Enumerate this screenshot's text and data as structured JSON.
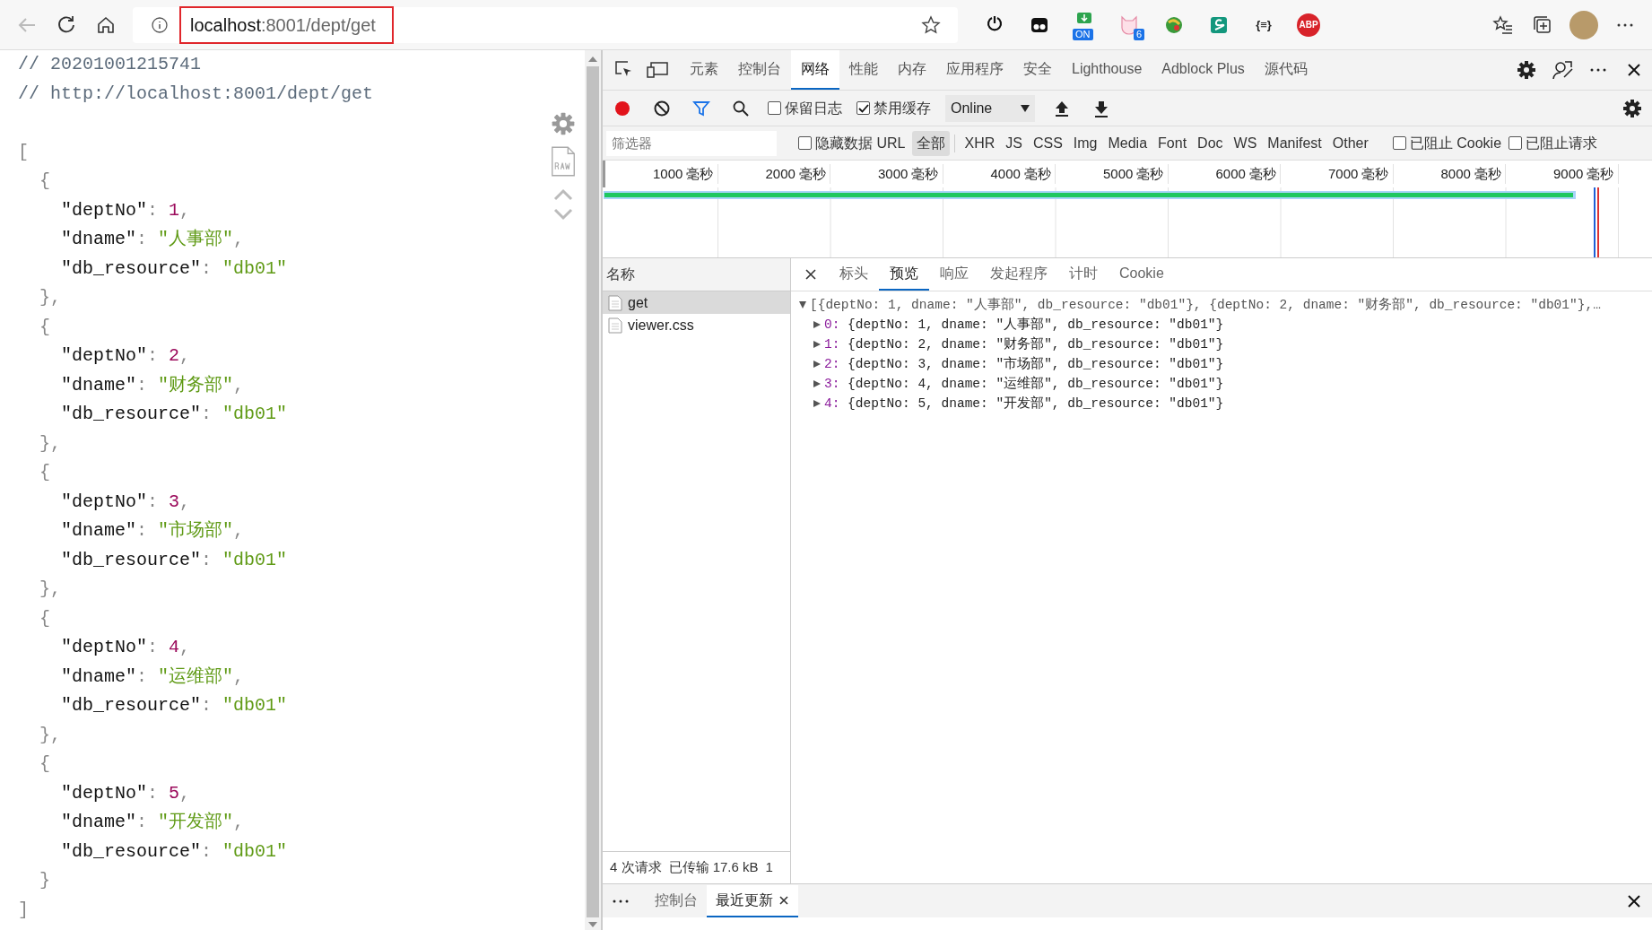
{
  "browser": {
    "url": {
      "host": "localhost",
      "path": ":8001/dept/get"
    },
    "extensions": [
      {
        "kind": "power"
      },
      {
        "kind": "eyes"
      },
      {
        "kind": "tile",
        "badge": "ON"
      },
      {
        "kind": "cat",
        "badge": "6"
      },
      {
        "kind": "globe"
      },
      {
        "kind": "wave"
      },
      {
        "kind": "text",
        "text": "{≡}"
      },
      {
        "kind": "stop",
        "text": "ABP"
      }
    ]
  },
  "viewer": {
    "comments": [
      "// 20201001215741",
      "// http://localhost:8001/dept/get"
    ],
    "open": "[",
    "close": "]",
    "records": [
      {
        "open": "{",
        "close": "},",
        "fields": [
          {
            "key": "\"deptNo\"",
            "colon": ":",
            "value": "1",
            "comma": ",",
            "kind": "number"
          },
          {
            "key": "\"dname\"",
            "colon": ":",
            "value": "\"人事部\"",
            "comma": ",",
            "kind": "string"
          },
          {
            "key": "\"db_resource\"",
            "colon": ":",
            "value": "\"db01\"",
            "kind": "string"
          }
        ]
      },
      {
        "open": "{",
        "close": "},",
        "fields": [
          {
            "key": "\"deptNo\"",
            "colon": ":",
            "value": "2",
            "comma": ",",
            "kind": "number"
          },
          {
            "key": "\"dname\"",
            "colon": ":",
            "value": "\"财务部\"",
            "comma": ",",
            "kind": "string"
          },
          {
            "key": "\"db_resource\"",
            "colon": ":",
            "value": "\"db01\"",
            "kind": "string"
          }
        ]
      },
      {
        "open": "{",
        "close": "},",
        "fields": [
          {
            "key": "\"deptNo\"",
            "colon": ":",
            "value": "3",
            "comma": ",",
            "kind": "number"
          },
          {
            "key": "\"dname\"",
            "colon": ":",
            "value": "\"市场部\"",
            "comma": ",",
            "kind": "string"
          },
          {
            "key": "\"db_resource\"",
            "colon": ":",
            "value": "\"db01\"",
            "kind": "string"
          }
        ]
      },
      {
        "open": "{",
        "close": "},",
        "fields": [
          {
            "key": "\"deptNo\"",
            "colon": ":",
            "value": "4",
            "comma": ",",
            "kind": "number"
          },
          {
            "key": "\"dname\"",
            "colon": ":",
            "value": "\"运维部\"",
            "comma": ",",
            "kind": "string"
          },
          {
            "key": "\"db_resource\"",
            "colon": ":",
            "value": "\"db01\"",
            "kind": "string"
          }
        ]
      },
      {
        "open": "{",
        "close": "}",
        "fields": [
          {
            "key": "\"deptNo\"",
            "colon": ":",
            "value": "5",
            "comma": ",",
            "kind": "number"
          },
          {
            "key": "\"dname\"",
            "colon": ":",
            "value": "\"开发部\"",
            "comma": ",",
            "kind": "string"
          },
          {
            "key": "\"db_resource\"",
            "colon": ":",
            "value": "\"db01\"",
            "kind": "string"
          }
        ]
      }
    ]
  },
  "devtools": {
    "tabs": [
      {
        "label": "元素",
        "selected": false
      },
      {
        "label": "控制台",
        "selected": false
      },
      {
        "label": "网络",
        "selected": true
      },
      {
        "label": "性能",
        "selected": false
      },
      {
        "label": "内存",
        "selected": false
      },
      {
        "label": "应用程序",
        "selected": false
      },
      {
        "label": "安全",
        "selected": false
      },
      {
        "label": "Lighthouse",
        "selected": false
      },
      {
        "label": "Adblock Plus",
        "selected": false
      },
      {
        "label": "源代码",
        "selected": false
      }
    ],
    "toolbar": {
      "recording": true,
      "filter_active": true,
      "preserve_log": {
        "label": "保留日志",
        "checked": false
      },
      "disable_cache": {
        "label": "禁用缓存",
        "checked": true
      },
      "throttling": "Online"
    },
    "filter_bar": {
      "placeholder": "筛选器",
      "hide_data_urls": {
        "label": "隐藏数据 URL",
        "checked": false
      },
      "types": [
        {
          "label": "全部",
          "selected": true
        },
        {
          "label": "XHR",
          "selected": false
        },
        {
          "label": "JS",
          "selected": false
        },
        {
          "label": "CSS",
          "selected": false
        },
        {
          "label": "Img",
          "selected": false
        },
        {
          "label": "Media",
          "selected": false
        },
        {
          "label": "Font",
          "selected": false
        },
        {
          "label": "Doc",
          "selected": false
        },
        {
          "label": "WS",
          "selected": false
        },
        {
          "label": "Manifest",
          "selected": false
        },
        {
          "label": "Other",
          "selected": false
        }
      ],
      "blocked_cookies": {
        "label": "已阻止 Cookie",
        "checked": false
      },
      "blocked_requests": {
        "label": "已阻止请求",
        "checked": false
      }
    },
    "timeline": {
      "ticks": [
        "1000 毫秒",
        "2000 毫秒",
        "3000 毫秒",
        "4000 毫秒",
        "5000 毫秒",
        "6000 毫秒",
        "7000 毫秒",
        "8000 毫秒",
        "9000 毫秒"
      ]
    },
    "requests": {
      "header": "名称",
      "items": [
        {
          "name": "get",
          "selected": true
        },
        {
          "name": "viewer.css",
          "selected": false
        }
      ]
    },
    "summary": [
      "4 次请求",
      "已传输 17.6 kB",
      "1"
    ],
    "detail": {
      "tabs": [
        {
          "label": "标头",
          "selected": false
        },
        {
          "label": "预览",
          "selected": true
        },
        {
          "label": "响应",
          "selected": false
        },
        {
          "label": "发起程序",
          "selected": false
        },
        {
          "label": "计时",
          "selected": false
        },
        {
          "label": "Cookie",
          "selected": false
        }
      ],
      "preview": {
        "summary": "[{deptNo: 1, dname: \"人事部\", db_resource: \"db01\"}, {deptNo: 2, dname: \"财务部\", db_resource: \"db01\"},…",
        "expanded": true,
        "items": [
          {
            "index": "0:",
            "text": "{deptNo: 1, dname: \"人事部\", db_resource: \"db01\"}",
            "expanded": false
          },
          {
            "index": "1:",
            "text": "{deptNo: 2, dname: \"财务部\", db_resource: \"db01\"}",
            "expanded": false
          },
          {
            "index": "2:",
            "text": "{deptNo: 3, dname: \"市场部\", db_resource: \"db01\"}",
            "expanded": false
          },
          {
            "index": "3:",
            "text": "{deptNo: 4, dname: \"运维部\", db_resource: \"db01\"}",
            "expanded": false
          },
          {
            "index": "4:",
            "text": "{deptNo: 5, dname: \"开发部\", db_resource: \"db01\"}",
            "expanded": false
          }
        ]
      }
    },
    "drawer": {
      "tabs": [
        {
          "label": "控制台",
          "selected": false,
          "closable": false
        },
        {
          "label": "最近更新",
          "selected": true,
          "closable": true
        }
      ]
    }
  }
}
